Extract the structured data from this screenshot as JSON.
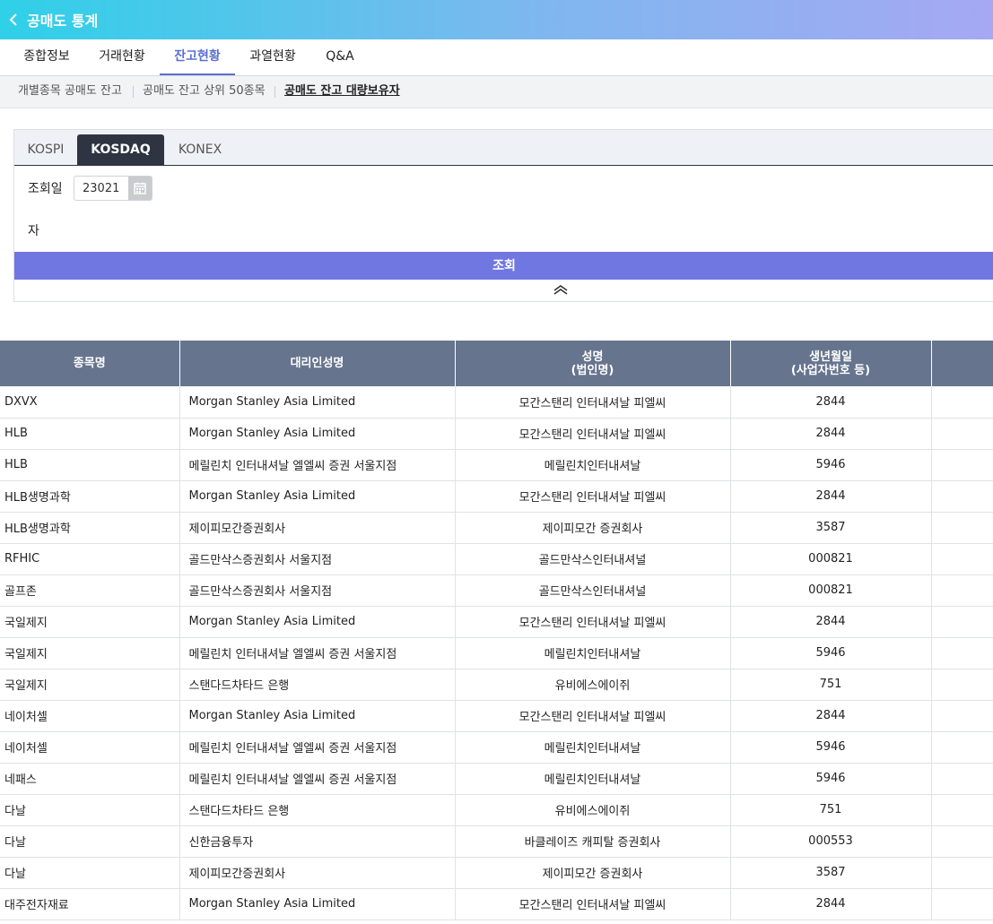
{
  "header": {
    "title": "공매도 통계"
  },
  "tabs": [
    {
      "label": "종합정보",
      "active": false
    },
    {
      "label": "거래현황",
      "active": false
    },
    {
      "label": "잔고현황",
      "active": true
    },
    {
      "label": "과열현황",
      "active": false
    },
    {
      "label": "Q&A",
      "active": false
    }
  ],
  "subnav": [
    {
      "label": "개별종목 공매도 잔고",
      "active": false
    },
    {
      "label": "공매도 잔고 상위 50종목",
      "active": false
    },
    {
      "label": "공매도 잔고 대량보유자",
      "active": true
    }
  ],
  "market_tabs": [
    {
      "label": "KOSPI",
      "active": false
    },
    {
      "label": "KOSDAQ",
      "active": true
    },
    {
      "label": "KONEX",
      "active": false
    }
  ],
  "filter": {
    "date_label": "조회일",
    "date_value": "23021",
    "extra_label": "자",
    "search_button": "조회"
  },
  "table": {
    "headers": [
      "종목명",
      "대리인성명",
      "성명\n(법인명)",
      "생년월일\n(사업자번호 등)",
      ""
    ],
    "rows": [
      [
        "DXVX",
        "Morgan Stanley Asia Limited",
        "모간스탠리 인터내셔날 피엘씨",
        "2844"
      ],
      [
        "HLB",
        "Morgan Stanley Asia Limited",
        "모간스탠리 인터내셔날 피엘씨",
        "2844"
      ],
      [
        "HLB",
        "메릴린치 인터내셔날 엘엘씨 증권 서울지점",
        "메릴린치인터내셔날",
        "5946"
      ],
      [
        "HLB생명과학",
        "Morgan Stanley Asia Limited",
        "모간스탠리 인터내셔날 피엘씨",
        "2844"
      ],
      [
        "HLB생명과학",
        "제이피모간증권회사",
        "제이피모간 증권회사",
        "3587"
      ],
      [
        "RFHIC",
        "골드만삭스증권회사 서울지점",
        "골드만삭스인터내셔널",
        "000821"
      ],
      [
        "골프존",
        "골드만삭스증권회사 서울지점",
        "골드만삭스인터내셔널",
        "000821"
      ],
      [
        "국일제지",
        "Morgan Stanley Asia Limited",
        "모간스탠리 인터내셔날 피엘씨",
        "2844"
      ],
      [
        "국일제지",
        "메릴린치 인터내셔날 엘엘씨 증권 서울지점",
        "메릴린치인터내셔날",
        "5946"
      ],
      [
        "국일제지",
        "스탠다드차타드 은행",
        "유비에스에이쥐",
        "751"
      ],
      [
        "네이처셀",
        "Morgan Stanley Asia Limited",
        "모간스탠리 인터내셔날 피엘씨",
        "2844"
      ],
      [
        "네이처셀",
        "메릴린치 인터내셔날 엘엘씨 증권 서울지점",
        "메릴린치인터내셔날",
        "5946"
      ],
      [
        "네패스",
        "메릴린치 인터내셔날 엘엘씨 증권 서울지점",
        "메릴린치인터내셔날",
        "5946"
      ],
      [
        "다날",
        "스탠다드차타드 은행",
        "유비에스에이쥐",
        "751"
      ],
      [
        "다날",
        "신한금융투자",
        "바클레이즈 캐피탈 증권회사",
        "000553"
      ],
      [
        "다날",
        "제이피모간증권회사",
        "제이피모간 증권회사",
        "3587"
      ],
      [
        "대주전자재료",
        "Morgan Stanley Asia Limited",
        "모간스탠리 인터내셔날 피엘씨",
        "2844"
      ]
    ]
  }
}
